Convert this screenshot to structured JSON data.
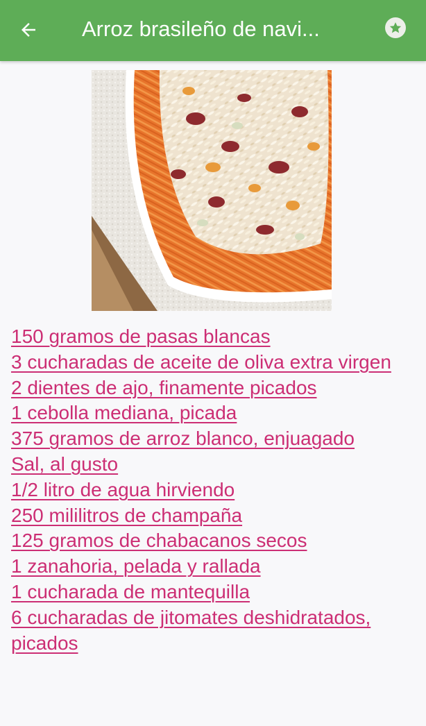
{
  "app_bar": {
    "title": "Arroz brasileño de navi...",
    "back_icon": "arrow-left-icon",
    "favorite_icon": "star-icon",
    "background_color": "#5ead57"
  },
  "recipe": {
    "image_icon": "rice-dish-photo",
    "ingredients": [
      "150 gramos de pasas blancas",
      "3 cucharadas de aceite de oliva extra virgen",
      "2 dientes de ajo, finamente picados",
      "1 cebolla mediana, picada",
      "375 gramos de arroz blanco, enjuagado",
      "Sal, al gusto",
      "1/2 litro de agua hirviendo",
      "250 mililitros de champaña",
      "125 gramos de chabacanos secos",
      "1 zanahoria, pelada y rallada",
      "1 cucharada de mantequilla",
      "6 cucharadas de jitomates deshidratados, picados"
    ],
    "link_color": "#cc2e74"
  }
}
